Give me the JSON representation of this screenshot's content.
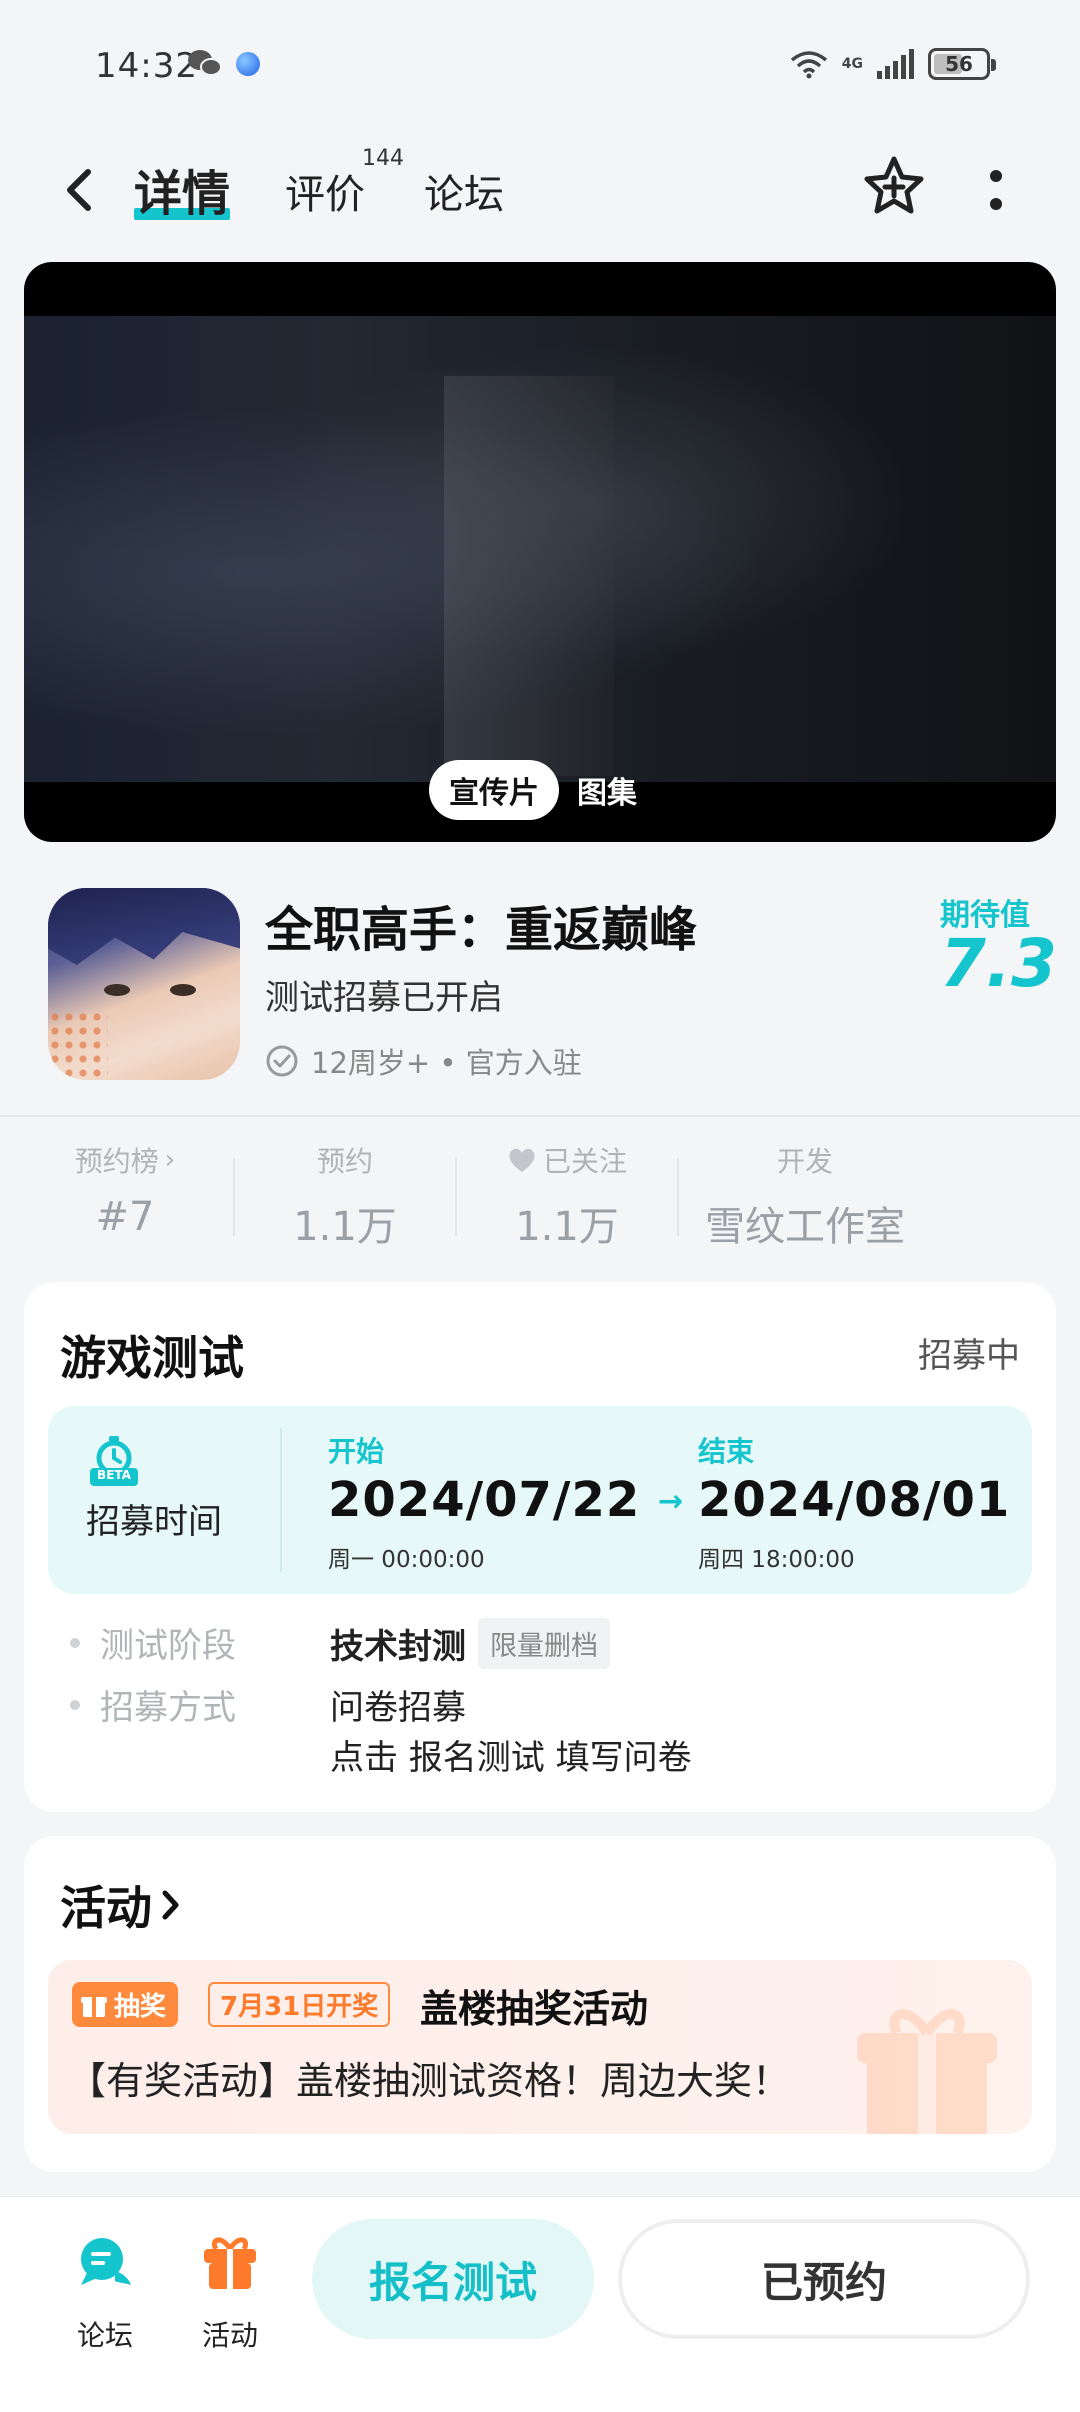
{
  "status_bar": {
    "time": "14:32",
    "battery": "56",
    "network": "4G"
  },
  "nav": {
    "tabs": [
      {
        "label": "详情"
      },
      {
        "label": "评价"
      },
      {
        "label": "论坛"
      }
    ],
    "review_count": "144"
  },
  "media": {
    "tabs": [
      {
        "label": "宣传片"
      },
      {
        "label": "图集"
      }
    ]
  },
  "game": {
    "title": "全职高手：重返巅峰",
    "subtitle": "测试招募已开启",
    "meta": "12周岁+ • 官方入驻",
    "expect_label": "期待值",
    "expect_value": "7.3"
  },
  "stats": [
    {
      "label": "预约榜",
      "value": "#7"
    },
    {
      "label": "预约",
      "value": "1.1万"
    },
    {
      "label": "已关注",
      "value": "1.1万"
    },
    {
      "label": "开发",
      "value": "雪纹工作室"
    }
  ],
  "test": {
    "title": "游戏测试",
    "status": "招募中",
    "time_label": "招募时间",
    "beta": "BETA",
    "start": {
      "head": "开始",
      "date": "2024/07/22",
      "day": "周一  00:00:00"
    },
    "end": {
      "head": "结束",
      "date": "2024/08/01",
      "day": "周四  18:00:00"
    },
    "arrow": "→",
    "stage_key": "测试阶段",
    "stage_val": "技术封测",
    "stage_tag": "限量删档",
    "method_key": "招募方式",
    "method_val": "问卷招募",
    "method_note": "点击 报名测试 填写问卷"
  },
  "activity": {
    "title": "活动",
    "badge": "抽奖",
    "date_badge": "7月31日开奖",
    "name": "盖楼抽奖活动",
    "desc": "【有奖活动】盖楼抽测试资格！周边大奖！"
  },
  "bottom_bar": {
    "forum": "论坛",
    "activity": "活动",
    "signup_button": "报名测试",
    "reserved_button": "已预约"
  },
  "colors": {
    "accent": "#15c5ce",
    "orange": "#ff8a3d"
  }
}
